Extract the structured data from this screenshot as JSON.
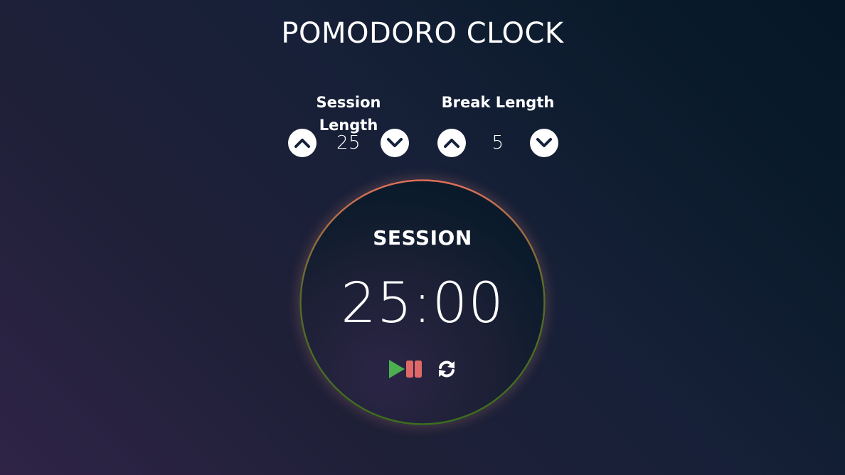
{
  "header": {
    "title": "POMODORO CLOCK"
  },
  "session_control": {
    "label": "Session Length",
    "value": "25",
    "increment_icon": "chevron-up-icon",
    "decrement_icon": "chevron-down-icon"
  },
  "break_control": {
    "label": "Break Length",
    "value": "5",
    "increment_icon": "chevron-up-icon",
    "decrement_icon": "chevron-down-icon"
  },
  "timer": {
    "label": "SESSION",
    "time": "25:00",
    "play_icon": "play-icon",
    "pause_icon": "pause-icon",
    "reset_icon": "refresh-icon"
  },
  "colors": {
    "play": "#4caf50",
    "pause": "#e16868",
    "ring_start": "#e0705a",
    "ring_end": "#3d6e1e",
    "icon_dark": "#13223a"
  }
}
